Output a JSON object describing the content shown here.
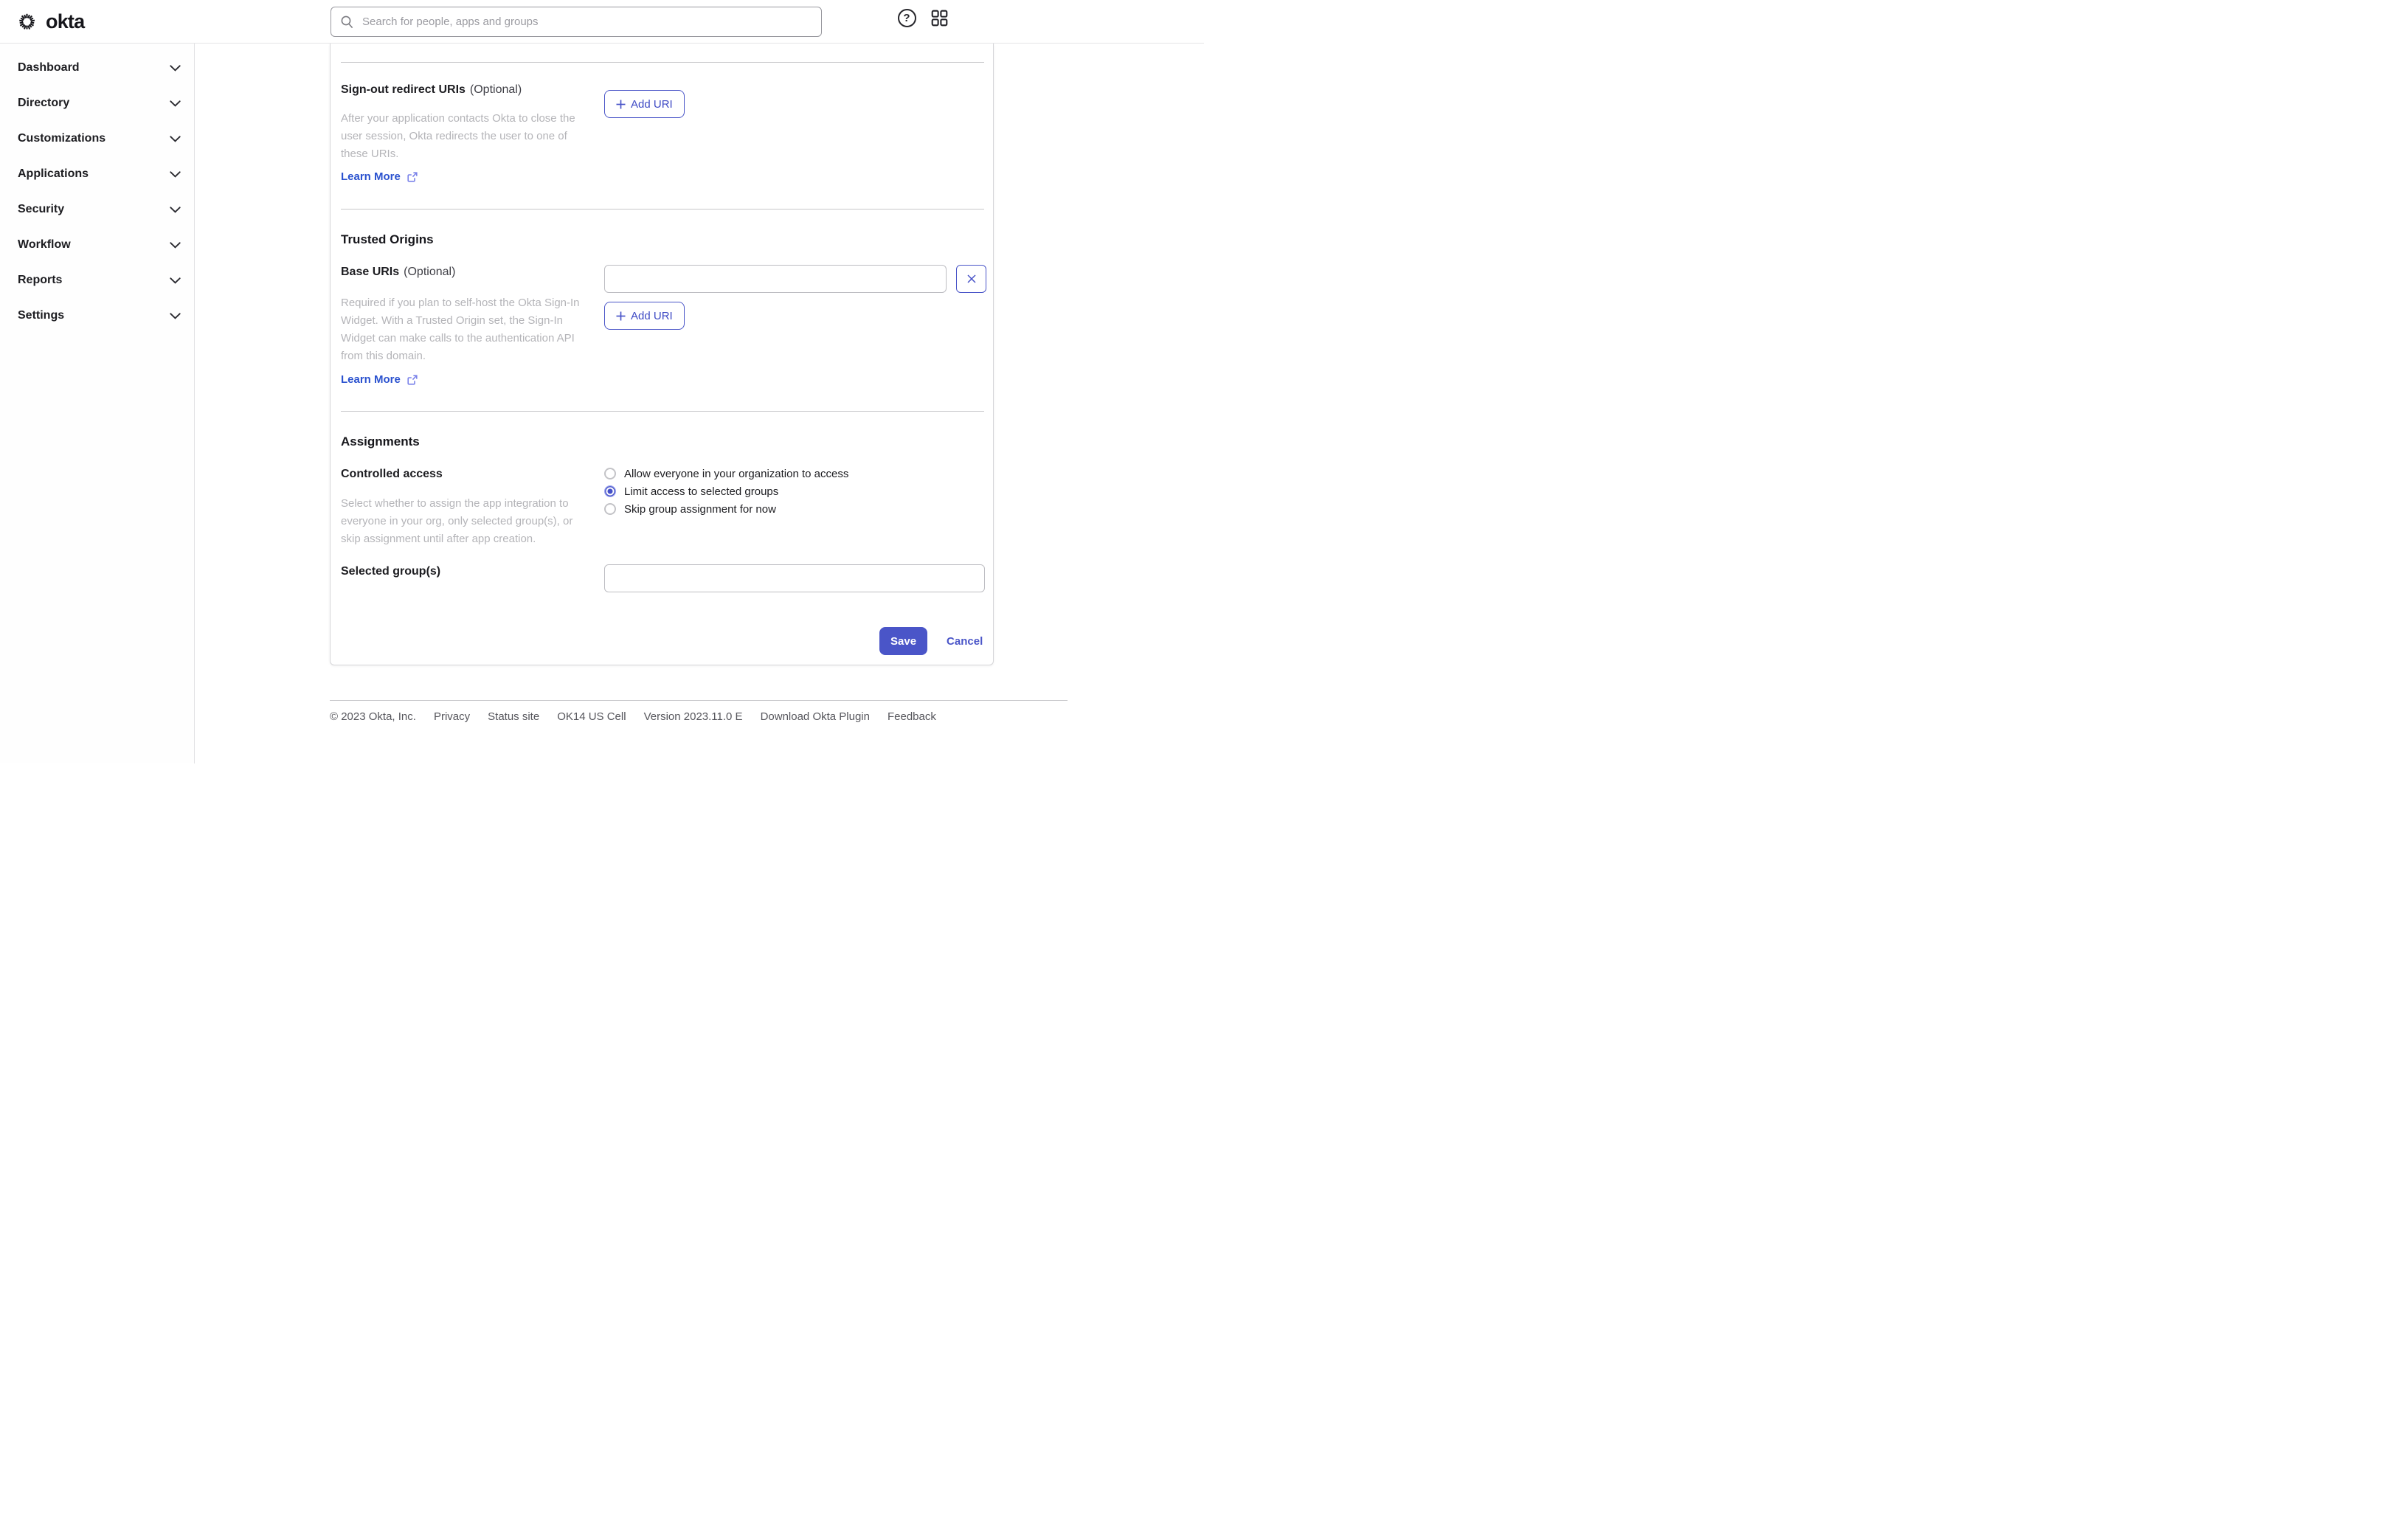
{
  "header": {
    "brand": "okta",
    "search_placeholder": "Search for people, apps and groups"
  },
  "sidebar": {
    "items": [
      {
        "label": "Dashboard"
      },
      {
        "label": "Directory"
      },
      {
        "label": "Customizations"
      },
      {
        "label": "Applications"
      },
      {
        "label": "Security"
      },
      {
        "label": "Workflow"
      },
      {
        "label": "Reports"
      },
      {
        "label": "Settings"
      }
    ]
  },
  "main": {
    "signout": {
      "label": "Sign-out redirect URIs",
      "optional": "(Optional)",
      "description": "After your application contacts Okta to close the user session, Okta redirects the user to one of these URIs.",
      "learn_more": "Learn More",
      "add_uri": "Add URI"
    },
    "trusted_origins": {
      "heading": "Trusted Origins",
      "base_uris_label": "Base URIs",
      "optional": "(Optional)",
      "base_uri_value": "",
      "description": "Required if you plan to self-host the Okta Sign-In Widget. With a Trusted Origin set, the Sign-In Widget can make calls to the authentication API from this domain.",
      "learn_more": "Learn More",
      "add_uri": "Add URI"
    },
    "assignments": {
      "heading": "Assignments",
      "controlled_access_label": "Controlled access",
      "description": "Select whether to assign the app integration to everyone in your org, only selected group(s), or skip assignment until after app creation.",
      "options": [
        {
          "label": "Allow everyone in your organization to access",
          "selected": false
        },
        {
          "label": "Limit access to selected groups",
          "selected": true
        },
        {
          "label": "Skip group assignment for now",
          "selected": false
        }
      ],
      "selected_groups_label": "Selected group(s)",
      "selected_groups_value": ""
    },
    "actions": {
      "save": "Save",
      "cancel": "Cancel"
    }
  },
  "footer": {
    "copyright": "© 2023 Okta, Inc.",
    "privacy": "Privacy",
    "status_site": "Status site",
    "cell": "OK14 US Cell",
    "version": "Version 2023.11.0 E",
    "download_plugin": "Download Okta Plugin",
    "feedback": "Feedback"
  },
  "icons": [
    "okta-sunburst-icon",
    "search-icon",
    "help-icon",
    "apps-grid-icon",
    "chevron-down-icon",
    "plus-icon",
    "external-link-icon",
    "close-icon"
  ],
  "colors": {
    "primary": "#4a55c8",
    "radio_selected": "#4450c8",
    "link": "#2b52cf",
    "text_dark": "#1d1d21",
    "muted_text": "#b4b4b8",
    "footer_text": "#56565c",
    "card_border": "#d6d6d9",
    "divider": "#c7c7ca"
  }
}
